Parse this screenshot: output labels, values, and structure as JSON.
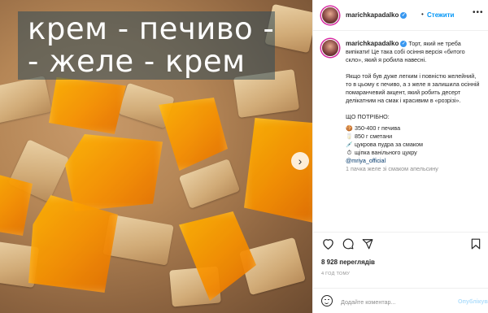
{
  "media": {
    "overlay_line1": "крем - печиво -",
    "overlay_line2": "- желе - крем",
    "next_icon": "chevron-right-icon"
  },
  "header": {
    "username": "marichkapadalko",
    "separator": "•",
    "follow_label": "Стежити",
    "more_icon": "more-horizontal-icon"
  },
  "caption": {
    "username": "marichkapadalko",
    "intro": "Торт, який не треба випікати! Це така собі осіння версія «битого скло», який я робила навесні.",
    "paragraph2": "Якщо той був дуже легким і повністю желейний, то в цьому є печиво, а з желе я залишила осінній помаранчевий акцент, який робить десерт делікатним на смак і красивим в «розрізі».",
    "needed_label": "ЩО ПОТРІБНО:",
    "items": [
      {
        "icon": "cookie-icon",
        "glyph": "🍪",
        "text": "350-400 г печива"
      },
      {
        "icon": "milk-icon",
        "glyph": "🥛",
        "text": "850 г сметани"
      },
      {
        "icon": "syringe-icon",
        "glyph": "💉",
        "text": "цукрова пудра за смаком"
      },
      {
        "icon": "stopwatch-icon",
        "glyph": "⏱",
        "text": "щіпка ванільного цукру"
      }
    ],
    "mention": "@mriya_official",
    "last_line": "1 пачка желе зі смаком апельсину"
  },
  "actions": {
    "like_icon": "heart-icon",
    "comment_icon": "comment-icon",
    "share_icon": "share-icon",
    "save_icon": "bookmark-icon"
  },
  "stats": {
    "views": "8 928 переглядів",
    "time_ago": "4 ГОД ТОМУ"
  },
  "comment": {
    "emoji_icon": "smiley-icon",
    "placeholder": "Додайте коментар...",
    "publish_label": "Опублікувати"
  },
  "colors": {
    "link_blue": "#0095f6",
    "verified_blue": "#3897f0",
    "text_gray": "#8e8e8e",
    "jelly_orange": "#f79000"
  }
}
